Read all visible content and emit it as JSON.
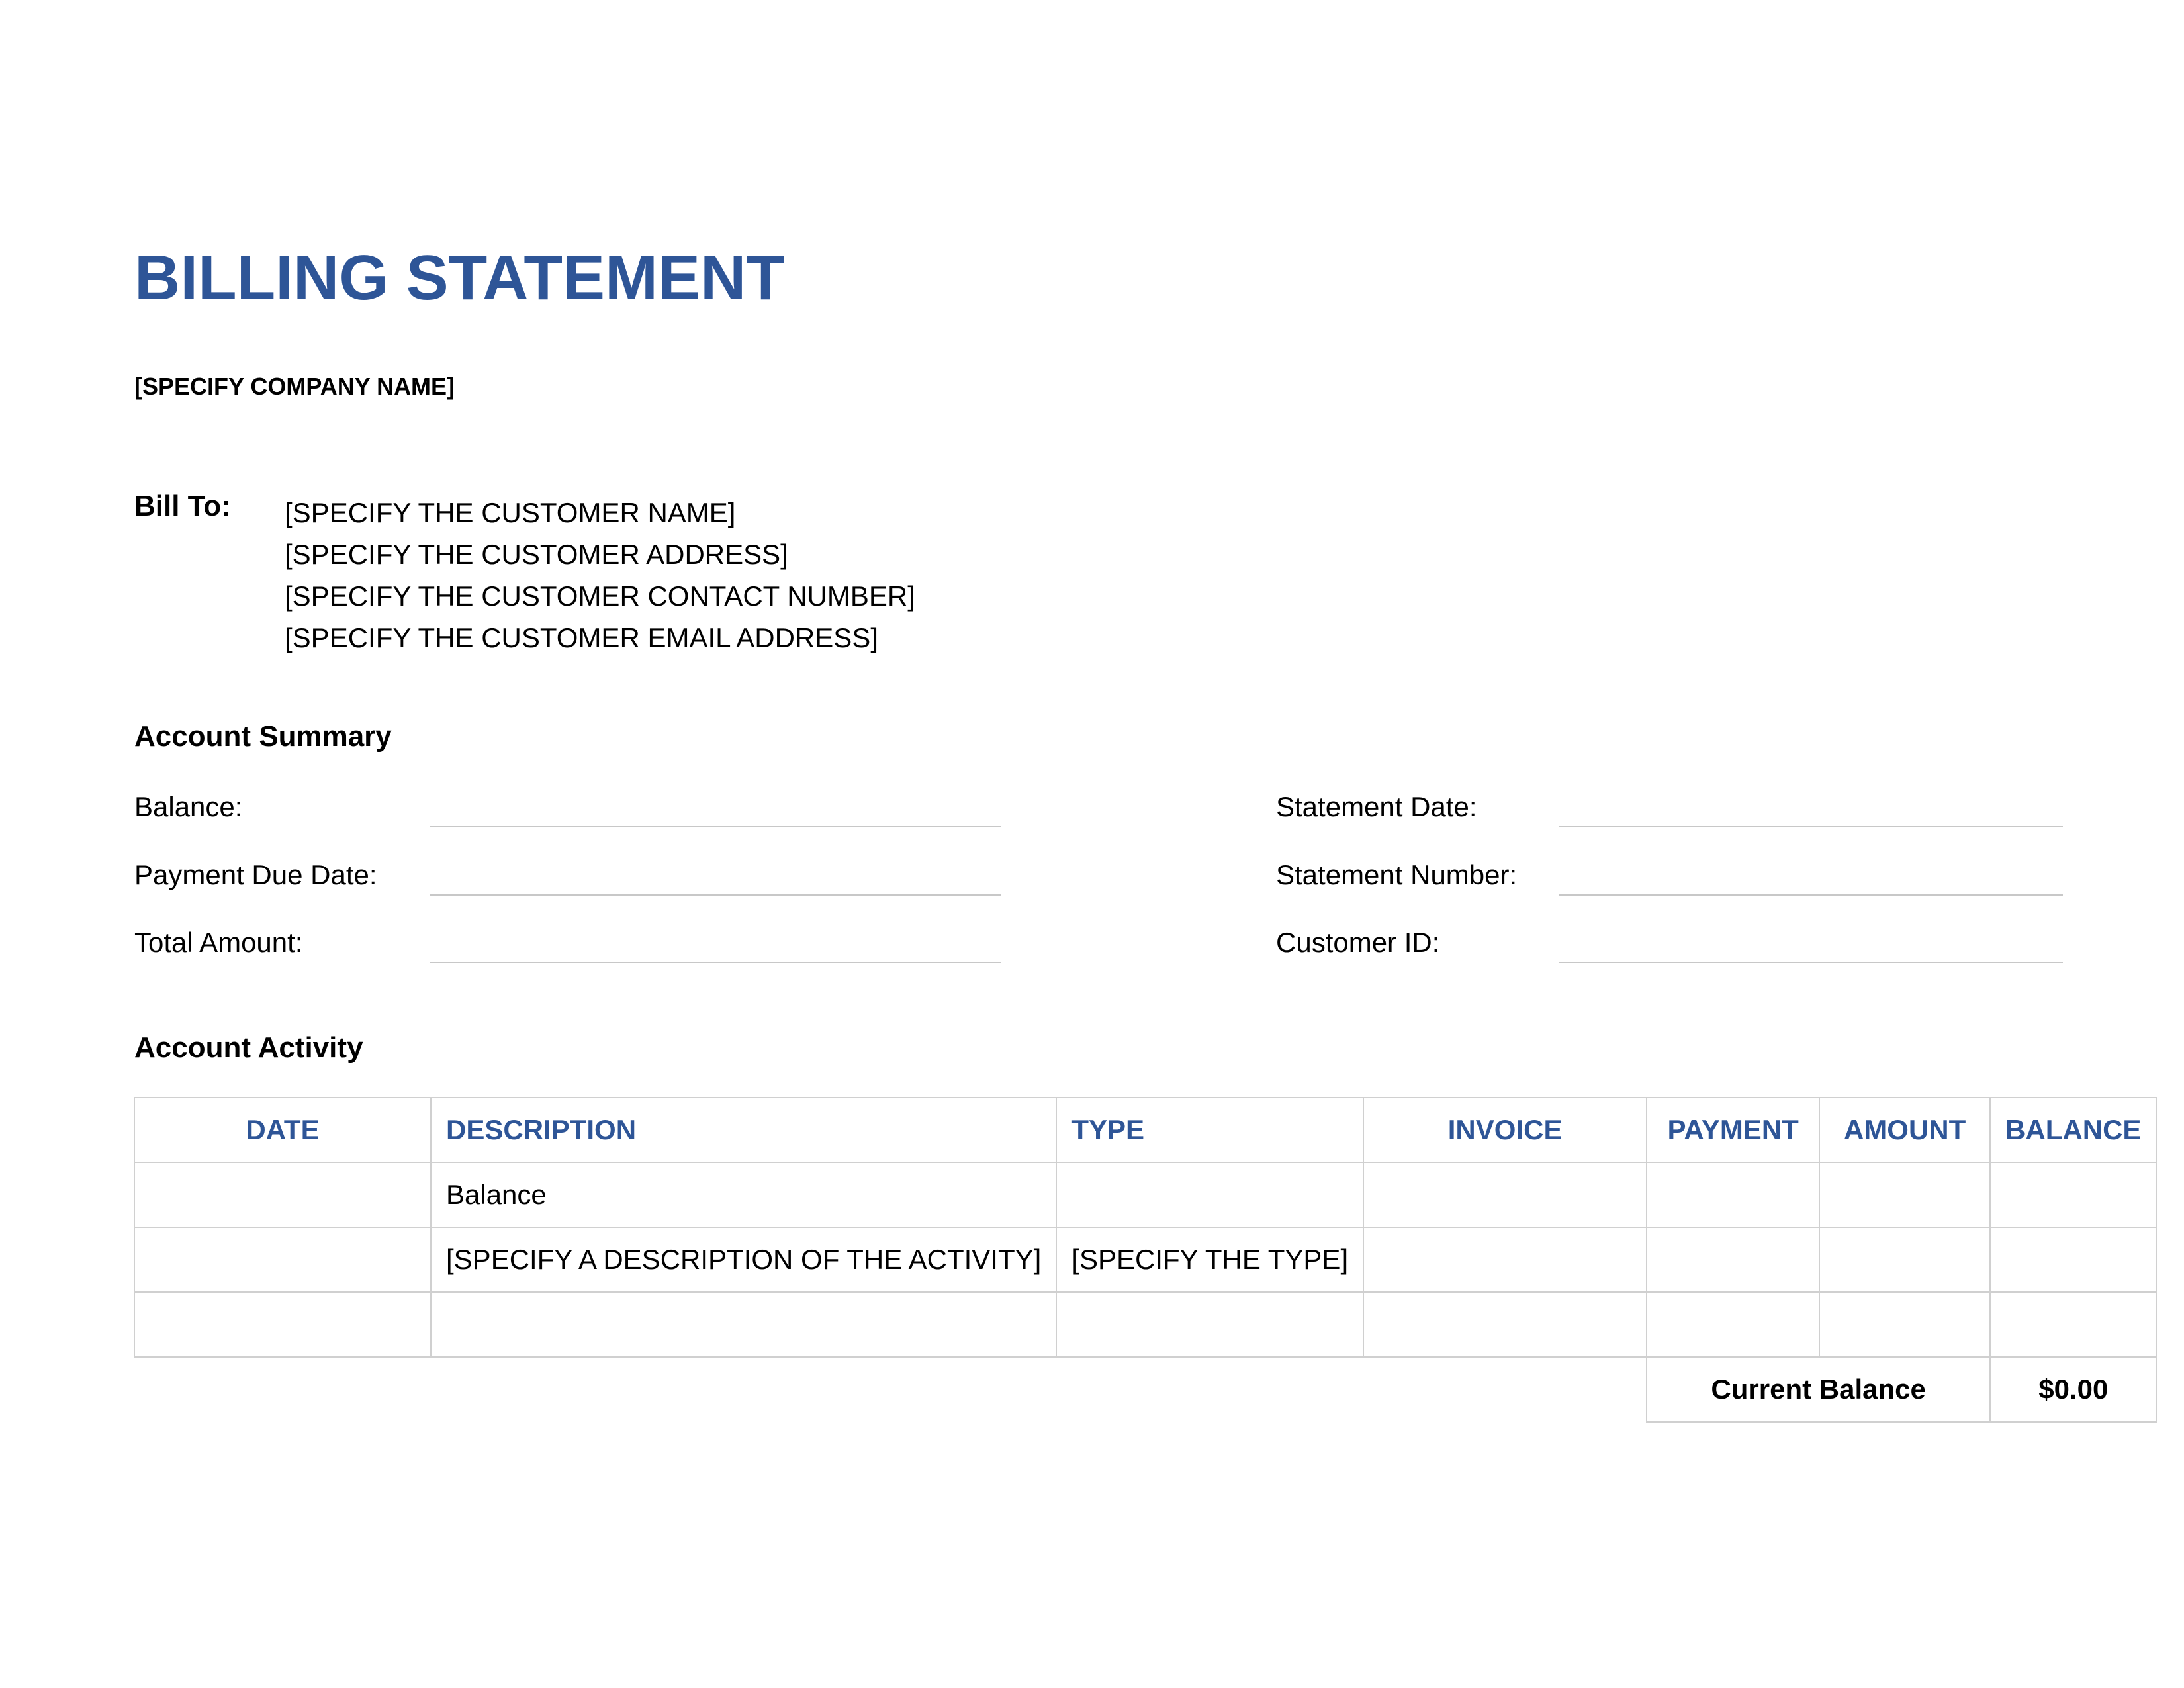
{
  "title": "BILLING STATEMENT",
  "company_name": "[SPECIFY COMPANY NAME]",
  "bill_to": {
    "label": "Bill To:",
    "lines": [
      "[SPECIFY THE CUSTOMER NAME]",
      "[SPECIFY THE CUSTOMER ADDRESS]",
      "[SPECIFY THE CUSTOMER CONTACT NUMBER]",
      "[SPECIFY THE CUSTOMER EMAIL ADDRESS]"
    ]
  },
  "account_summary": {
    "heading": "Account Summary",
    "left_fields": [
      {
        "label": "Balance:",
        "value": ""
      },
      {
        "label": "Payment Due Date:",
        "value": ""
      },
      {
        "label": "Total Amount:",
        "value": ""
      }
    ],
    "right_fields": [
      {
        "label": "Statement Date:",
        "value": ""
      },
      {
        "label": "Statement Number:",
        "value": ""
      },
      {
        "label": "Customer ID:",
        "value": ""
      }
    ]
  },
  "account_activity": {
    "heading": "Account Activity",
    "columns": [
      "DATE",
      "DESCRIPTION",
      "TYPE",
      "INVOICE",
      "PAYMENT",
      "AMOUNT",
      "BALANCE"
    ],
    "rows": [
      [
        "",
        "Balance",
        "",
        "",
        "",
        "",
        ""
      ],
      [
        "",
        "[SPECIFY A DESCRIPTION OF THE ACTIVITY]",
        "[SPECIFY THE TYPE]",
        "",
        "",
        "",
        ""
      ],
      [
        "",
        "",
        "",
        "",
        "",
        "",
        ""
      ]
    ],
    "current_balance_label": "Current Balance",
    "current_balance_value": "$0.00"
  }
}
